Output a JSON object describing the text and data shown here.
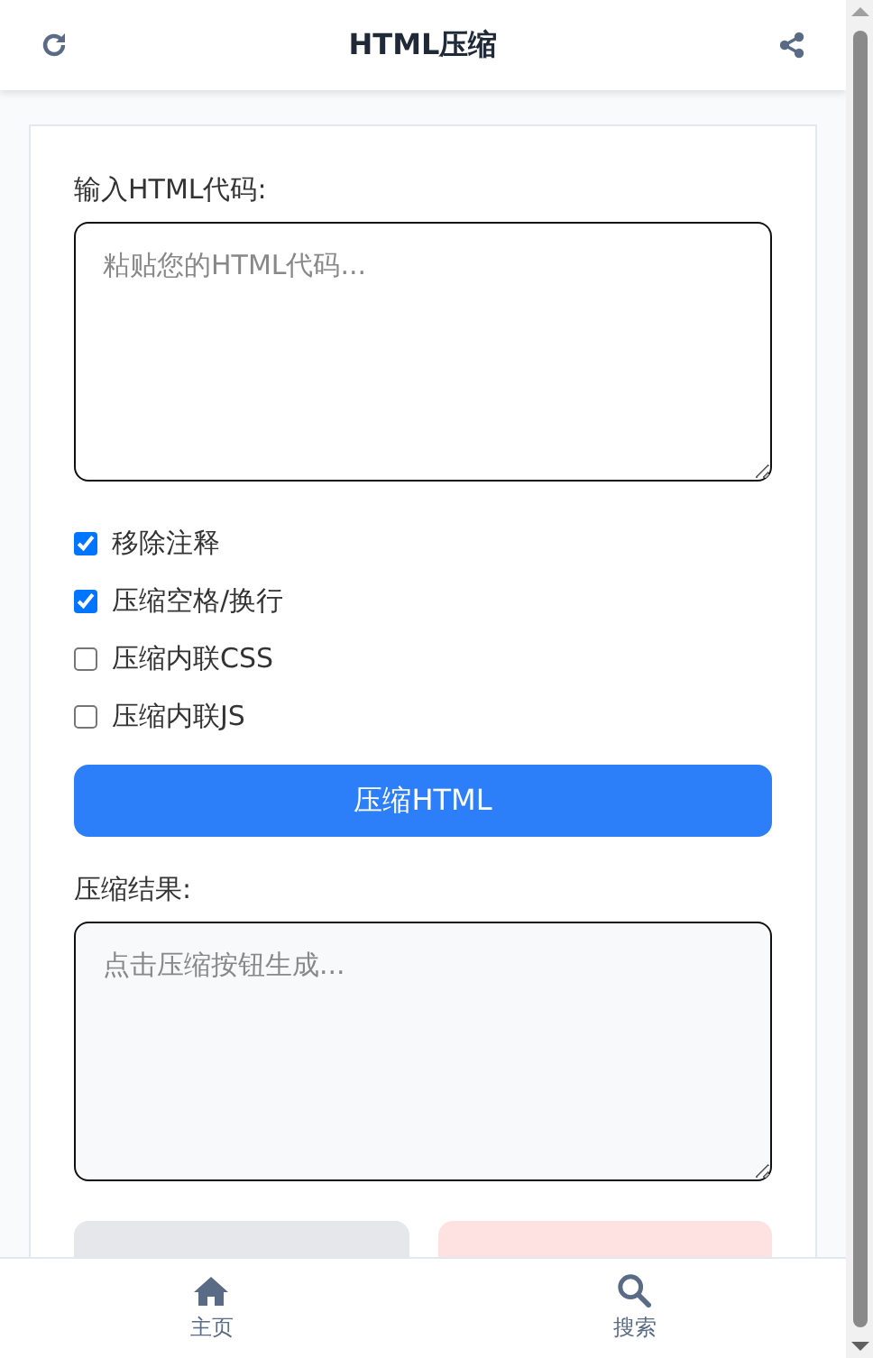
{
  "header": {
    "title": "HTML压缩"
  },
  "input": {
    "label": "输入HTML代码:",
    "placeholder": "粘贴您的HTML代码..."
  },
  "options": [
    {
      "label": "移除注释",
      "checked": true
    },
    {
      "label": "压缩空格/换行",
      "checked": true
    },
    {
      "label": "压缩内联CSS",
      "checked": false
    },
    {
      "label": "压缩内联JS",
      "checked": false
    }
  ],
  "compress_button": "压缩HTML",
  "output": {
    "label": "压缩结果:",
    "placeholder": "点击压缩按钮生成..."
  },
  "actions": [
    {
      "kind": "neutral"
    },
    {
      "kind": "danger"
    }
  ],
  "bottom_nav": [
    {
      "label": "主页",
      "kind": "home"
    },
    {
      "label": "搜索",
      "kind": "search"
    }
  ]
}
